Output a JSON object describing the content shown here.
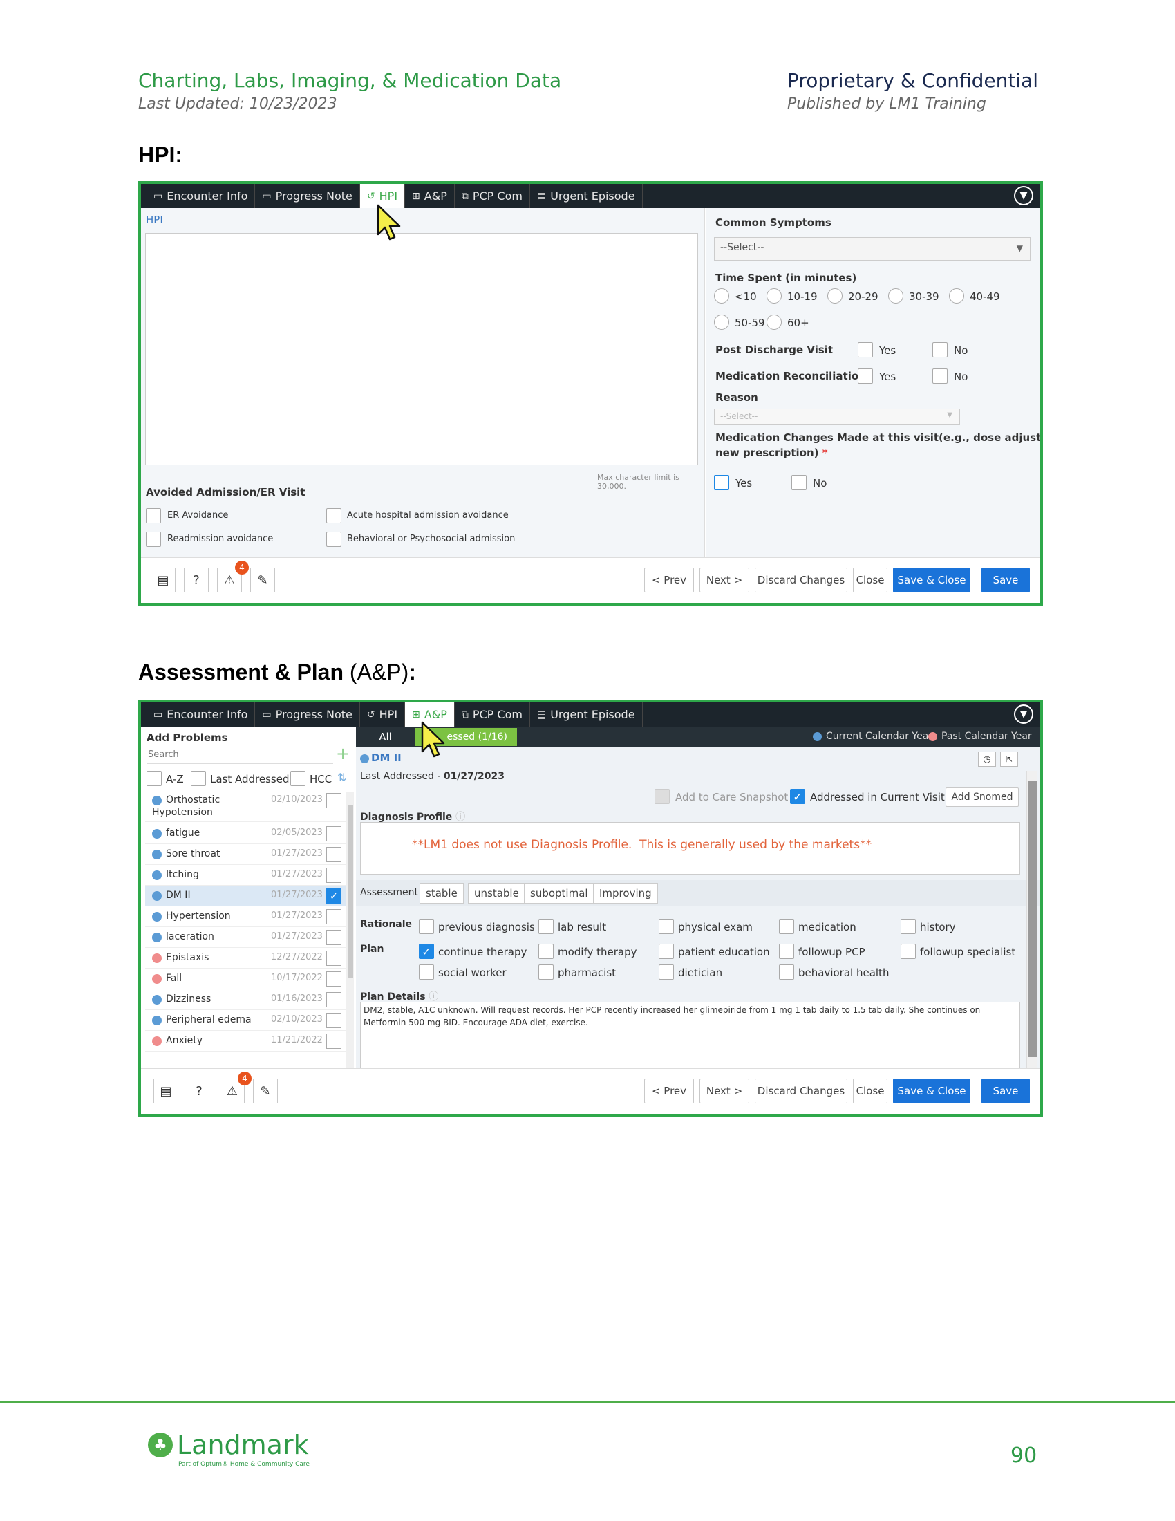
{
  "header": {
    "title": "Charting, Labs, Imaging, & Medication Data",
    "updated": "Last Updated: 10/23/2023",
    "right_title": "Proprietary & Confidential",
    "right_sub": "Published by LM1 Training"
  },
  "sections": {
    "hpi_title": "HPI:",
    "ap_title_bold": "Assessment & Plan",
    "ap_title_paren": " (A&P)",
    "ap_title_colon": ":"
  },
  "tabs": {
    "encounter_info": "Encounter Info",
    "progress_note": "Progress Note",
    "hpi": "HPI",
    "ap": "A&P",
    "pcp_com": "PCP Com",
    "urgent_episode": "Urgent Episode"
  },
  "hpi_screen": {
    "hpi_label": "HPI",
    "max_chars": "Max character limit is 30,000.",
    "avoided_title": "Avoided Admission/ER Visit",
    "er_avoidance": "ER Avoidance",
    "acute_hospital": "Acute hospital admission avoidance",
    "readmission": "Readmission avoidance",
    "behavioral": "Behavioral or Psychosocial admission",
    "common_symptoms": "Common Symptoms",
    "select_placeholder": "--Select--",
    "time_spent": "Time Spent (in minutes)",
    "time_options": [
      "<10",
      "10-19",
      "20-29",
      "30-39",
      "40-49",
      "50-59",
      "60+"
    ],
    "post_discharge": "Post Discharge Visit",
    "med_reconciliation": "Medication Reconciliation",
    "yes": "Yes",
    "no": "No",
    "reason": "Reason",
    "reason_placeholder": "--Select--",
    "med_changes_line1": "Medication Changes Made at this visit(e.g., dose adjustment,",
    "med_changes_line2": "new prescription)",
    "required_mark": "*",
    "badge_count": "4"
  },
  "buttons": {
    "prev": "< Prev",
    "next": "Next >",
    "discard": "Discard Changes",
    "close": "Close",
    "save_close": "Save & Close",
    "save": "Save"
  },
  "ap_screen": {
    "add_problems": "Add Problems",
    "search_placeholder": "Search",
    "sort_az": "A-Z",
    "sort_last": "Last Addressed",
    "sort_hcc": "HCC",
    "filter_all": "All",
    "filter_addressed": "Addressed (1/16)",
    "filter_addressed_visible": "essed (1/16)",
    "legend_current": "Current Calendar Year",
    "legend_past": "Past Calendar Year",
    "problem_title": "DM II",
    "last_addressed_label": "Last Addressed - ",
    "last_addressed_date": "01/27/2023",
    "add_care_snapshot": "Add to Care Snapshot",
    "addressed_current": "Addressed in Current Visit",
    "add_snomed": "Add Snomed",
    "diagnosis_profile": "Diagnosis Profile",
    "dx_note": "**LM1 does not use Diagnosis Profile.  This is generally used by the markets**",
    "assessment_label": "Assessment",
    "assessment_options": [
      "stable",
      "unstable",
      "suboptimal",
      "Improving"
    ],
    "rationale_label": "Rationale",
    "rationale_options": [
      "previous diagnosis",
      "lab result",
      "physical exam",
      "medication",
      "history"
    ],
    "plan_label": "Plan",
    "plan_options_row1": [
      "continue therapy",
      "modify therapy",
      "patient education",
      "followup PCP",
      "followup specialist"
    ],
    "plan_options_row2": [
      "social worker",
      "pharmacist",
      "dietician",
      "behavioral health"
    ],
    "plan_details_label": "Plan Details",
    "plan_details_line1": "DM2, stable, A1C unknown. Will request records. Her PCP recently increased her glimepiride from 1 mg 1 tab daily to 1.5 tab daily. She continues on",
    "plan_details_line2": "Metformin 500 mg BID. Encourage ADA diet, exercise.",
    "problems": [
      {
        "name": "Orthostatic",
        "name2": "Hypotension",
        "date": "02/10/2023",
        "color": "#5b9bd5"
      },
      {
        "name": "fatigue",
        "date": "02/05/2023",
        "color": "#5b9bd5"
      },
      {
        "name": "Sore throat",
        "date": "01/27/2023",
        "color": "#5b9bd5"
      },
      {
        "name": "Itching",
        "date": "01/27/2023",
        "color": "#5b9bd5"
      },
      {
        "name": "DM II",
        "date": "01/27/2023",
        "color": "#5b9bd5"
      },
      {
        "name": "Hypertension",
        "date": "01/27/2023",
        "color": "#5b9bd5"
      },
      {
        "name": "laceration",
        "date": "01/27/2023",
        "color": "#5b9bd5"
      },
      {
        "name": "Epistaxis",
        "date": "12/27/2022",
        "color": "#f08c8c"
      },
      {
        "name": "Fall",
        "date": "10/17/2022",
        "color": "#f08c8c"
      },
      {
        "name": "Dizziness",
        "date": "01/16/2023",
        "color": "#5b9bd5"
      },
      {
        "name": "Peripheral edema",
        "date": "02/10/2023",
        "color": "#5b9bd5"
      },
      {
        "name": "Anxiety",
        "date": "11/21/2022",
        "color": "#f08c8c"
      }
    ]
  },
  "footer": {
    "logo": "Landmark",
    "logo_sub": "Part of Optum® Home & Community Care",
    "page_number": "90"
  }
}
